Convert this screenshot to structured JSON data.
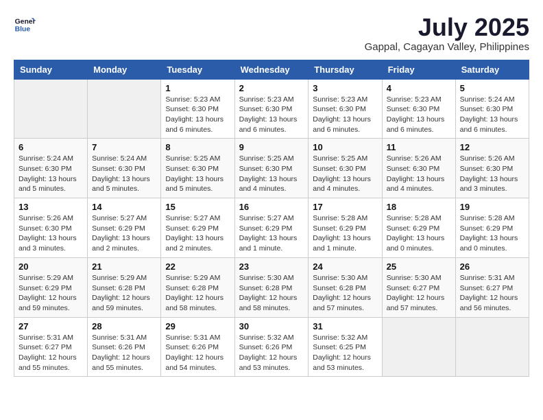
{
  "header": {
    "logo_line1": "General",
    "logo_line2": "Blue",
    "month_year": "July 2025",
    "location": "Gappal, Cagayan Valley, Philippines"
  },
  "weekdays": [
    "Sunday",
    "Monday",
    "Tuesday",
    "Wednesday",
    "Thursday",
    "Friday",
    "Saturday"
  ],
  "weeks": [
    [
      {
        "day": "",
        "info": ""
      },
      {
        "day": "",
        "info": ""
      },
      {
        "day": "1",
        "info": "Sunrise: 5:23 AM\nSunset: 6:30 PM\nDaylight: 13 hours and 6 minutes."
      },
      {
        "day": "2",
        "info": "Sunrise: 5:23 AM\nSunset: 6:30 PM\nDaylight: 13 hours and 6 minutes."
      },
      {
        "day": "3",
        "info": "Sunrise: 5:23 AM\nSunset: 6:30 PM\nDaylight: 13 hours and 6 minutes."
      },
      {
        "day": "4",
        "info": "Sunrise: 5:23 AM\nSunset: 6:30 PM\nDaylight: 13 hours and 6 minutes."
      },
      {
        "day": "5",
        "info": "Sunrise: 5:24 AM\nSunset: 6:30 PM\nDaylight: 13 hours and 6 minutes."
      }
    ],
    [
      {
        "day": "6",
        "info": "Sunrise: 5:24 AM\nSunset: 6:30 PM\nDaylight: 13 hours and 5 minutes."
      },
      {
        "day": "7",
        "info": "Sunrise: 5:24 AM\nSunset: 6:30 PM\nDaylight: 13 hours and 5 minutes."
      },
      {
        "day": "8",
        "info": "Sunrise: 5:25 AM\nSunset: 6:30 PM\nDaylight: 13 hours and 5 minutes."
      },
      {
        "day": "9",
        "info": "Sunrise: 5:25 AM\nSunset: 6:30 PM\nDaylight: 13 hours and 4 minutes."
      },
      {
        "day": "10",
        "info": "Sunrise: 5:25 AM\nSunset: 6:30 PM\nDaylight: 13 hours and 4 minutes."
      },
      {
        "day": "11",
        "info": "Sunrise: 5:26 AM\nSunset: 6:30 PM\nDaylight: 13 hours and 4 minutes."
      },
      {
        "day": "12",
        "info": "Sunrise: 5:26 AM\nSunset: 6:30 PM\nDaylight: 13 hours and 3 minutes."
      }
    ],
    [
      {
        "day": "13",
        "info": "Sunrise: 5:26 AM\nSunset: 6:30 PM\nDaylight: 13 hours and 3 minutes."
      },
      {
        "day": "14",
        "info": "Sunrise: 5:27 AM\nSunset: 6:29 PM\nDaylight: 13 hours and 2 minutes."
      },
      {
        "day": "15",
        "info": "Sunrise: 5:27 AM\nSunset: 6:29 PM\nDaylight: 13 hours and 2 minutes."
      },
      {
        "day": "16",
        "info": "Sunrise: 5:27 AM\nSunset: 6:29 PM\nDaylight: 13 hours and 1 minute."
      },
      {
        "day": "17",
        "info": "Sunrise: 5:28 AM\nSunset: 6:29 PM\nDaylight: 13 hours and 1 minute."
      },
      {
        "day": "18",
        "info": "Sunrise: 5:28 AM\nSunset: 6:29 PM\nDaylight: 13 hours and 0 minutes."
      },
      {
        "day": "19",
        "info": "Sunrise: 5:28 AM\nSunset: 6:29 PM\nDaylight: 13 hours and 0 minutes."
      }
    ],
    [
      {
        "day": "20",
        "info": "Sunrise: 5:29 AM\nSunset: 6:29 PM\nDaylight: 12 hours and 59 minutes."
      },
      {
        "day": "21",
        "info": "Sunrise: 5:29 AM\nSunset: 6:28 PM\nDaylight: 12 hours and 59 minutes."
      },
      {
        "day": "22",
        "info": "Sunrise: 5:29 AM\nSunset: 6:28 PM\nDaylight: 12 hours and 58 minutes."
      },
      {
        "day": "23",
        "info": "Sunrise: 5:30 AM\nSunset: 6:28 PM\nDaylight: 12 hours and 58 minutes."
      },
      {
        "day": "24",
        "info": "Sunrise: 5:30 AM\nSunset: 6:28 PM\nDaylight: 12 hours and 57 minutes."
      },
      {
        "day": "25",
        "info": "Sunrise: 5:30 AM\nSunset: 6:27 PM\nDaylight: 12 hours and 57 minutes."
      },
      {
        "day": "26",
        "info": "Sunrise: 5:31 AM\nSunset: 6:27 PM\nDaylight: 12 hours and 56 minutes."
      }
    ],
    [
      {
        "day": "27",
        "info": "Sunrise: 5:31 AM\nSunset: 6:27 PM\nDaylight: 12 hours and 55 minutes."
      },
      {
        "day": "28",
        "info": "Sunrise: 5:31 AM\nSunset: 6:26 PM\nDaylight: 12 hours and 55 minutes."
      },
      {
        "day": "29",
        "info": "Sunrise: 5:31 AM\nSunset: 6:26 PM\nDaylight: 12 hours and 54 minutes."
      },
      {
        "day": "30",
        "info": "Sunrise: 5:32 AM\nSunset: 6:26 PM\nDaylight: 12 hours and 53 minutes."
      },
      {
        "day": "31",
        "info": "Sunrise: 5:32 AM\nSunset: 6:25 PM\nDaylight: 12 hours and 53 minutes."
      },
      {
        "day": "",
        "info": ""
      },
      {
        "day": "",
        "info": ""
      }
    ]
  ]
}
